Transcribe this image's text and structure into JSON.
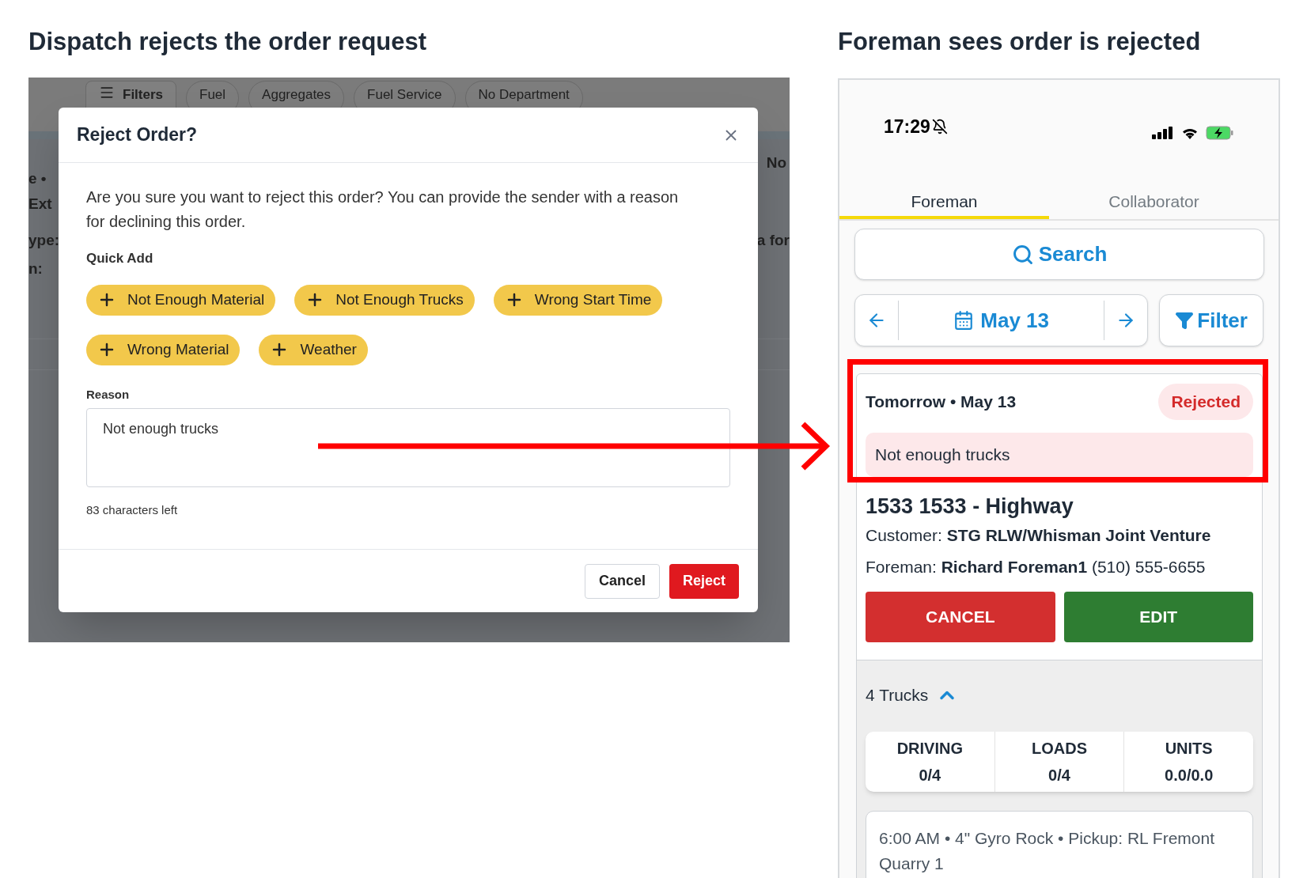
{
  "left_heading": "Dispatch rejects the order request",
  "right_heading": "Foreman sees order is rejected",
  "background_app": {
    "filter_chips": [
      {
        "label": "Filters",
        "kind": "menu"
      },
      {
        "label": "Fuel",
        "kind": "tag"
      },
      {
        "label": "Aggregates",
        "kind": "tag"
      },
      {
        "label": "Fuel Service",
        "kind": "tag"
      },
      {
        "label": "No Department",
        "kind": "tag"
      }
    ],
    "fragments": [
      "e •",
      "Ext",
      "ype:",
      "n:",
      "No",
      "a for"
    ]
  },
  "dialog": {
    "title": "Reject Order?",
    "message": "Are you sure you want to reject this order? You can provide the sender with a reason for declining this order.",
    "quick_add_label": "Quick Add",
    "quick_add": [
      "Not Enough Material",
      "Not Enough Trucks",
      "Wrong Start Time",
      "Wrong Material",
      "Weather"
    ],
    "reason_label": "Reason",
    "reason_value": "Not enough trucks",
    "chars_left": "83 characters left",
    "buttons": [
      {
        "label": "Cancel",
        "kind": "secondary"
      },
      {
        "label": "Reject",
        "kind": "danger"
      }
    ]
  },
  "phone": {
    "time": "17:29",
    "tabs": [
      {
        "label": "Foreman",
        "selected": true
      },
      {
        "label": "Collaborator",
        "selected": false
      }
    ],
    "search": "Search",
    "date": "May 13",
    "filter": "Filter",
    "order": {
      "date_line": "Tomorrow • May 13",
      "status": "Rejected",
      "reason": "Not enough trucks",
      "title": "1533 1533 - Highway",
      "customer": "Customer: **STG RLW/Whisman Joint Venture**",
      "foreman": "Foreman: **Richard Foreman1** (510) 555-6655",
      "actions": [
        {
          "label": "CANCEL",
          "kind": "danger"
        },
        {
          "label": "EDIT",
          "kind": "primary"
        }
      ],
      "trucks": "4 Trucks",
      "trucks_expanded": true,
      "stats": [
        {
          "label": "DRIVING",
          "value": "0/4"
        },
        {
          "label": "LOADS",
          "value": "0/4"
        },
        {
          "label": "UNITS",
          "value": "0.0/0.0"
        }
      ],
      "load_line": "6:00 AM • 4\" Gyro Rock • Pickup: RL Fremont Quarry 1"
    }
  }
}
